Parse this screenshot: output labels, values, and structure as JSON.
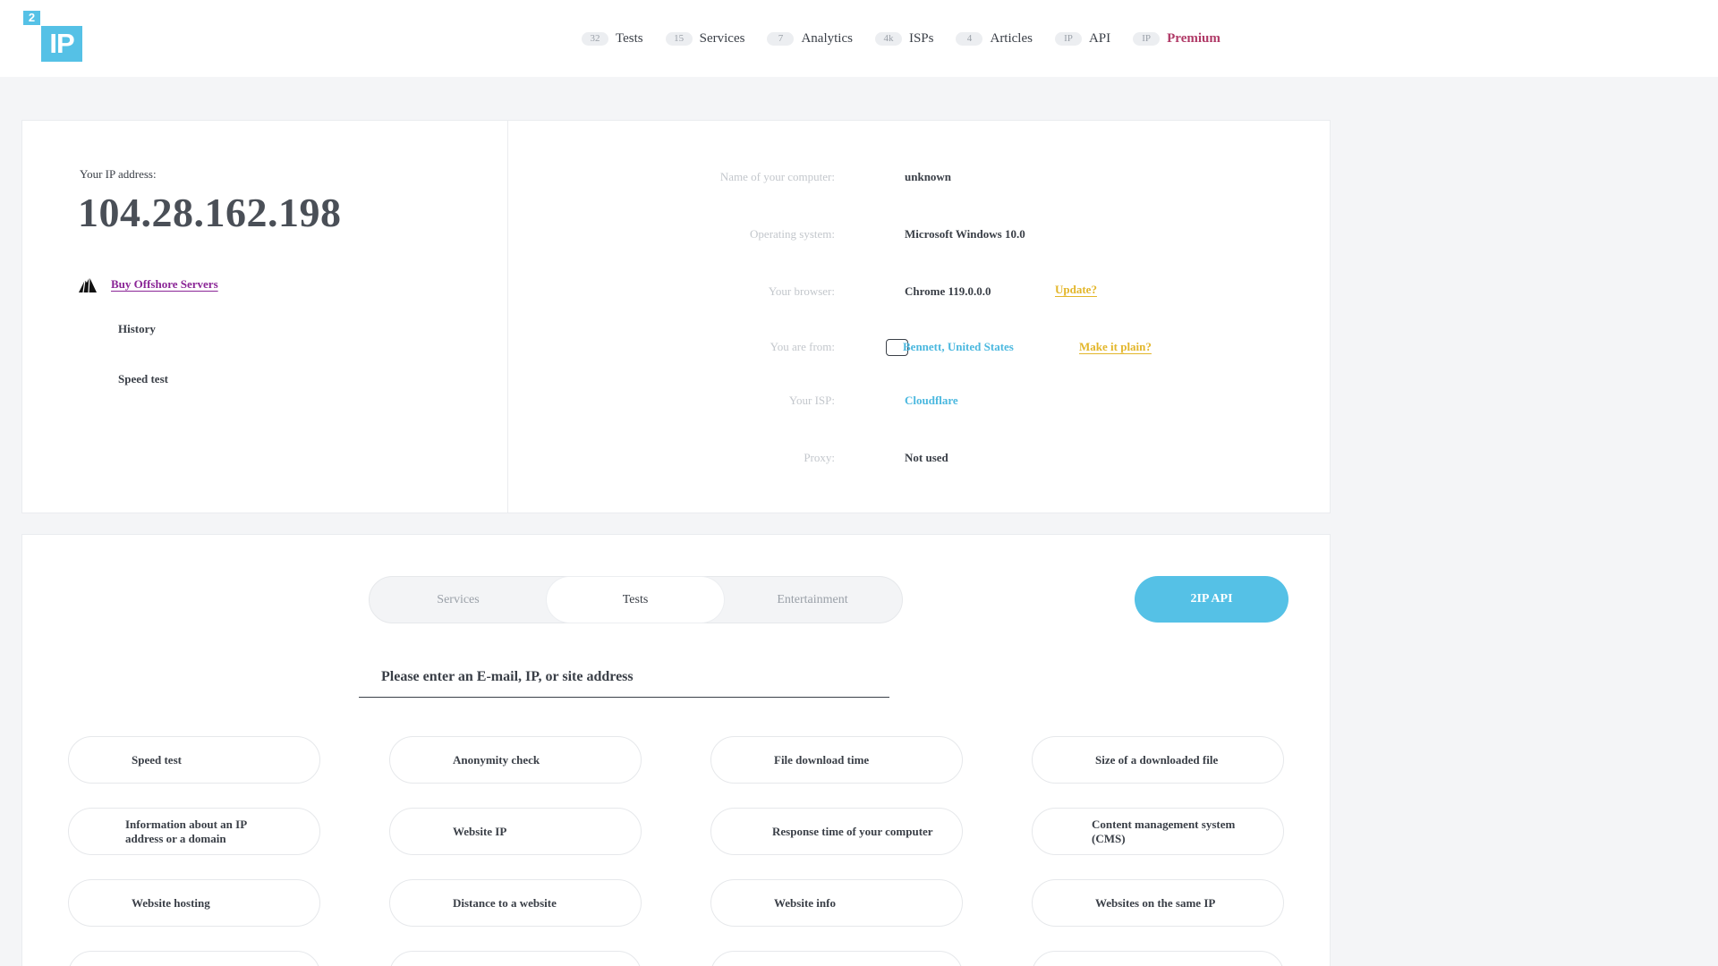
{
  "header": {
    "logo": {
      "small": "2",
      "big": "IP"
    },
    "nav": [
      {
        "badge": "32",
        "label": "Tests"
      },
      {
        "badge": "15",
        "label": "Services"
      },
      {
        "badge": "7",
        "label": "Analytics"
      },
      {
        "badge": "4k",
        "label": "ISPs"
      },
      {
        "badge": "4",
        "label": "Articles"
      },
      {
        "badge": "IP",
        "label": "API"
      },
      {
        "badge": "IP",
        "label": "Premium"
      }
    ]
  },
  "ip_panel": {
    "caption": "Your IP address:",
    "ip": "104.28.162.198",
    "offshore_link": "Buy Offshore Servers",
    "history": "History",
    "speed_test": "Speed test"
  },
  "details": {
    "computer_name": {
      "label": "Name of your computer:",
      "value": "unknown"
    },
    "os": {
      "label": "Operating system:",
      "value": "Microsoft Windows 10.0"
    },
    "browser": {
      "label": "Your browser:",
      "value": "Chrome 119.0.0.0",
      "action": "Update?"
    },
    "location": {
      "label": "You are from:",
      "value": "Bennett, United States",
      "action": "Make it plain?"
    },
    "isp": {
      "label": "Your ISP:",
      "value": "Cloudflare"
    },
    "proxy": {
      "label": "Proxy:",
      "value": "Not used"
    }
  },
  "tools": {
    "tabs": [
      "Services",
      "Tests",
      "Entertainment"
    ],
    "active_tab": "Tests",
    "api_button": "2IP API",
    "search_placeholder": "Please enter an E-mail, IP, or site address",
    "items": [
      "Speed test",
      "Anonymity check",
      "File download time",
      "Size of a downloaded file",
      "Information about an IP address or a domain",
      "Website IP",
      "Response time of your computer",
      "Content management system (CMS)",
      "Website hosting",
      "Distance to a website",
      "Website info",
      "Websites on the same IP"
    ]
  },
  "colors": {
    "brand": "#55c1e6",
    "premium": "#b03a67",
    "offshore_link": "#8a2596",
    "action_link": "#e3b62a"
  }
}
